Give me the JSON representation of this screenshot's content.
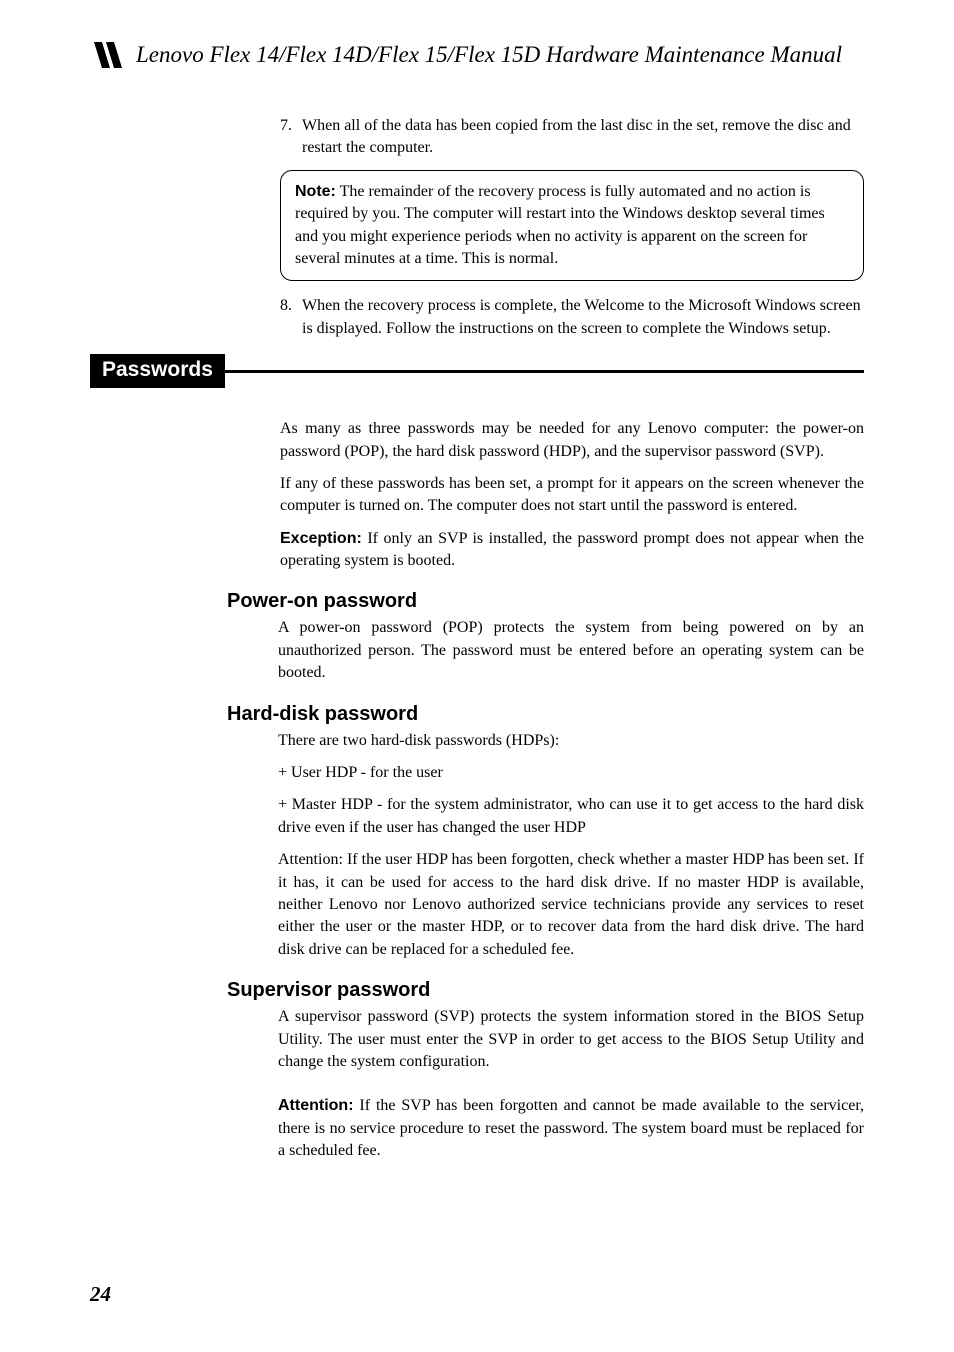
{
  "header": {
    "title": "Lenovo Flex 14/Flex 14D/Flex 15/Flex 15D Hardware Maintenance Manual"
  },
  "step7": {
    "num": "7.",
    "text": "When all of the data has been copied from the last disc in the set, remove the disc and restart the computer."
  },
  "note": {
    "label": "Note:",
    "text": " The remainder of the recovery process is fully automated and no action is required by you. The computer will restart into the Windows desktop several times and you might experience periods when no activity is apparent on the screen for several minutes at a time. This is normal."
  },
  "step8": {
    "num": "8.",
    "text": "When the recovery process is complete, the Welcome to the Microsoft Windows screen is displayed. Follow the instructions on the screen to complete the Windows setup."
  },
  "passwords": {
    "title": "Passwords",
    "intro1": "As many as three passwords may be needed for any Lenovo computer: the power-on password (POP), the hard disk password (HDP), and the supervisor password (SVP).",
    "intro2": "If any of these passwords has been set, a prompt for it appears on the screen whenever the computer is turned on. The computer does not start until the password is entered.",
    "exceptionLabel": "Exception:",
    "exceptionText": " If only an SVP is installed, the password prompt does not appear when the operating system is booted."
  },
  "powerOn": {
    "title": "Power-on password",
    "text": "A power-on password (POP) protects the system from being powered on by an unauthorized person. The password must be entered before an operating system can be booted."
  },
  "hardDisk": {
    "title": "Hard-disk password",
    "intro": "There are two hard-disk passwords (HDPs):",
    "bullet1": "+ User HDP - for the user",
    "bullet2": "+ Master HDP - for the system administrator, who can use it to get access to the hard disk drive even if the user has changed the user HDP",
    "attention": "Attention: If the user HDP has been forgotten, check whether a master HDP has been set. If it has, it can be used for access to the hard disk drive. If no master HDP is available, neither Lenovo nor Lenovo authorized service technicians provide any services to reset either the user or the master HDP, or to recover data from the hard disk drive. The hard disk drive can be replaced for a scheduled fee."
  },
  "supervisor": {
    "title": "Supervisor password",
    "text": "A supervisor password (SVP) protects the system information stored in the BIOS Setup Utility. The user must enter the SVP in order to get access to the BIOS Setup Utility and change the system configuration.",
    "attentionLabel": "Attention:",
    "attentionText": " If the SVP has been forgotten and cannot be made available to the servicer, there is no service procedure to reset the password. The system board must be replaced for a scheduled fee."
  },
  "pageNumber": "24"
}
